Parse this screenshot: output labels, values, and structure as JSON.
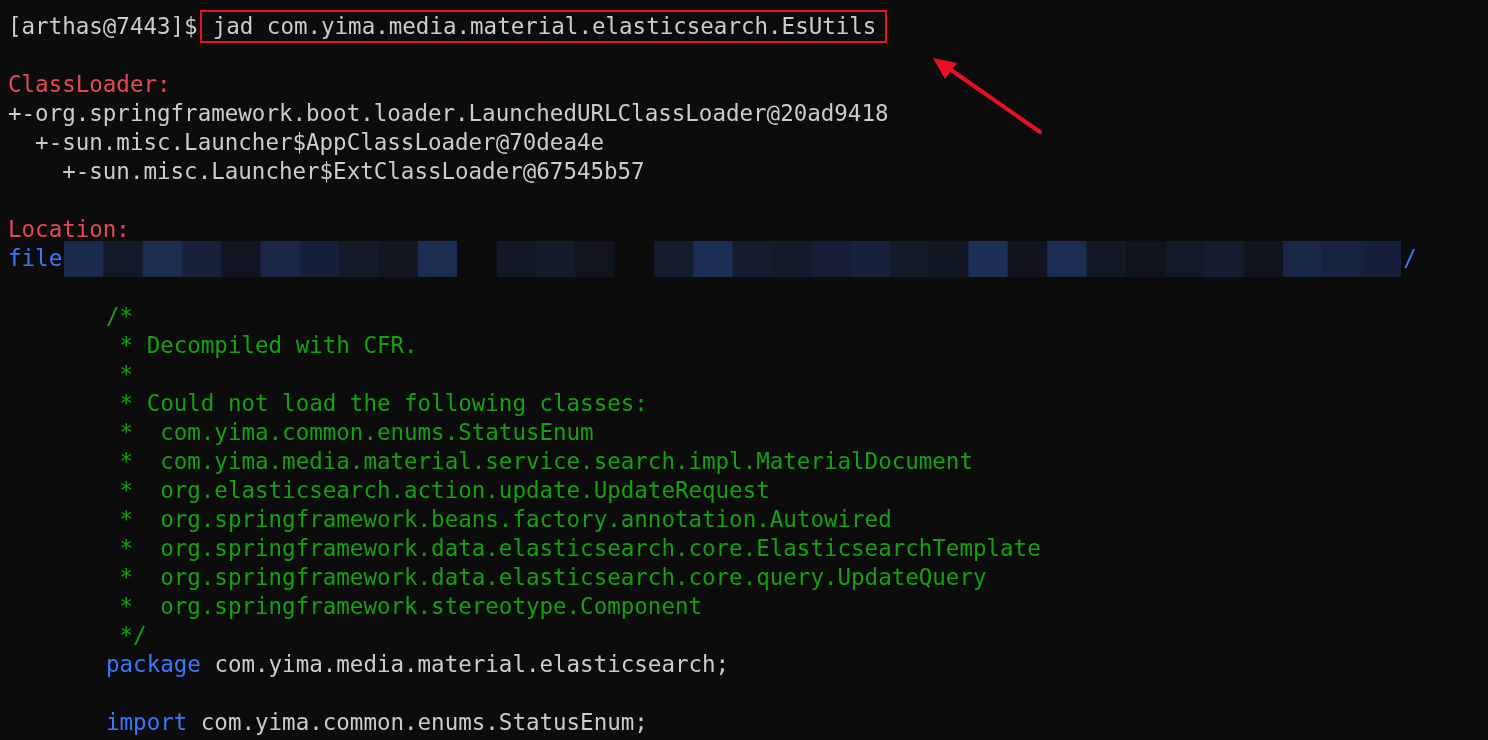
{
  "terminal": {
    "lines": [
      {
        "kind": "prompt",
        "prompt": "[arthas@7443]$",
        "command": "jad com.yima.media.material.elasticsearch.EsUtils",
        "highlighted": true
      },
      {
        "kind": "blank"
      },
      {
        "kind": "heading",
        "text": "ClassLoader:"
      },
      {
        "kind": "text",
        "text": "+-org.springframework.boot.loader.LaunchedURLClassLoader@20ad9418"
      },
      {
        "kind": "text",
        "text": "  +-sun.misc.Launcher$AppClassLoader@70dea4e"
      },
      {
        "kind": "text",
        "text": "    +-sun.misc.Launcher$ExtClassLoader@67545b57"
      },
      {
        "kind": "blank"
      },
      {
        "kind": "heading",
        "text": "Location:"
      },
      {
        "kind": "path",
        "scheme": "file",
        "tail": "/"
      },
      {
        "kind": "blank"
      },
      {
        "kind": "comment",
        "text": "/*"
      },
      {
        "kind": "comment",
        "text": " * Decompiled with CFR."
      },
      {
        "kind": "comment",
        "text": " *"
      },
      {
        "kind": "comment",
        "text": " * Could not load the following classes:"
      },
      {
        "kind": "comment",
        "text": " *  com.yima.common.enums.StatusEnum"
      },
      {
        "kind": "comment",
        "text": " *  com.yima.media.material.service.search.impl.MaterialDocument"
      },
      {
        "kind": "comment",
        "text": " *  org.elasticsearch.action.update.UpdateRequest"
      },
      {
        "kind": "comment",
        "text": " *  org.springframework.beans.factory.annotation.Autowired"
      },
      {
        "kind": "comment",
        "text": " *  org.springframework.data.elasticsearch.core.ElasticsearchTemplate"
      },
      {
        "kind": "comment",
        "text": " *  org.springframework.data.elasticsearch.core.query.UpdateQuery"
      },
      {
        "kind": "comment",
        "text": " *  org.springframework.stereotype.Component"
      },
      {
        "kind": "comment",
        "text": " */"
      },
      {
        "kind": "code",
        "keyword": "package",
        "text": "com.yima.media.material.elasticsearch;"
      },
      {
        "kind": "blank"
      },
      {
        "kind": "code",
        "keyword": "import",
        "text": "com.yima.common.enums.StatusEnum;"
      }
    ]
  }
}
